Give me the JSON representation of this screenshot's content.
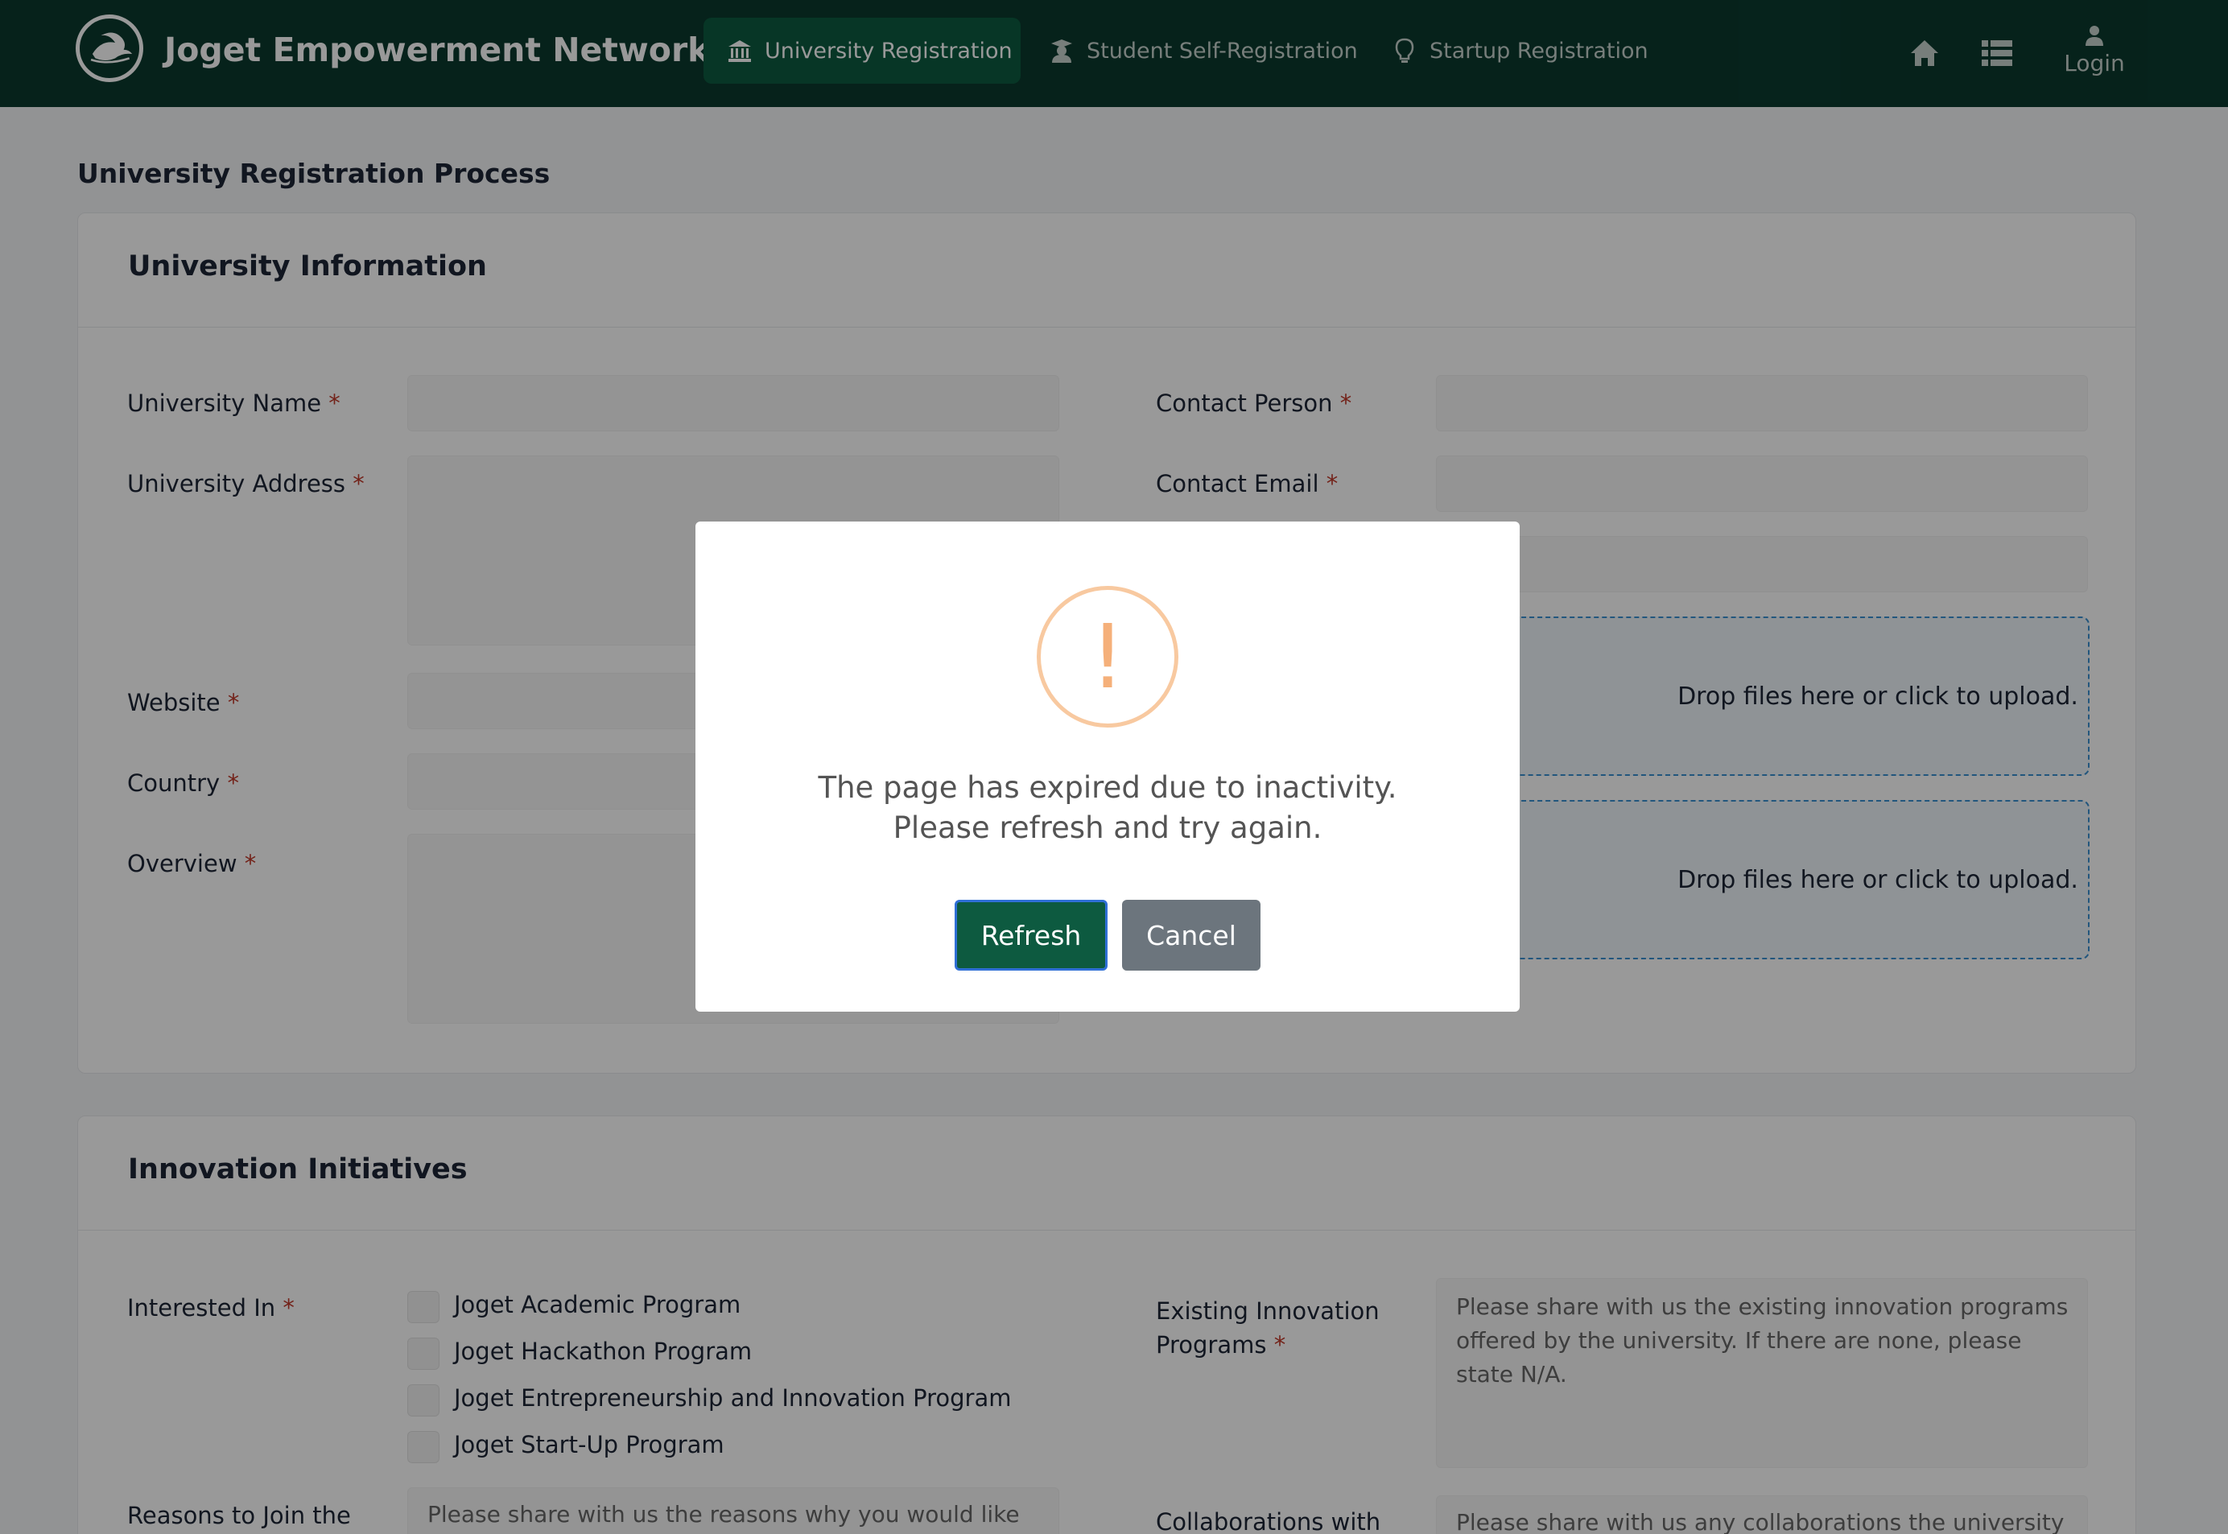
{
  "navbar": {
    "brand": "Joget Empowerment Network",
    "items": [
      {
        "label": "University Registration",
        "icon": "university-icon",
        "active": true
      },
      {
        "label": "Student Self-Registration",
        "icon": "graduate-icon",
        "active": false
      },
      {
        "label": "Startup Registration",
        "icon": "lightbulb-icon",
        "active": false
      }
    ],
    "home_icon": "home-icon",
    "list_icon": "list-icon",
    "login_label": "Login"
  },
  "page": {
    "title": "University Registration Process"
  },
  "university_info": {
    "title": "University Information",
    "fields": {
      "university_name": "University Name",
      "contact_person": "Contact Person",
      "university_address": "University Address",
      "contact_email": "Contact Email",
      "website": "Website",
      "country": "Country",
      "overview": "Overview"
    },
    "required_mark": "*",
    "dropzone_text_1": "Drop files here or click to upload.",
    "dropzone_text_2": "Drop files here or click to upload."
  },
  "innovation": {
    "title": "Innovation Initiatives",
    "interested_in_label": "Interested In",
    "options": [
      "Joget Academic Program",
      "Joget Hackathon Program",
      "Joget Entrepreneurship and Innovation Program",
      "Joget Start-Up Program"
    ],
    "existing_label_1": "Existing Innovation",
    "existing_label_2": "Programs",
    "existing_placeholder": "Please share with us the existing innovation programs offered by the university. If there are none, please state N/A.",
    "reasons_label": "Reasons to Join the",
    "reasons_placeholder": "Please share with us the reasons why you would like",
    "collab_label": "Collaborations with",
    "collab_placeholder": "Please share with us any collaborations the university"
  },
  "modal": {
    "icon": "!",
    "line1": "The page has expired due to inactivity.",
    "line2": "Please refresh and try again.",
    "refresh_label": "Refresh",
    "cancel_label": "Cancel"
  },
  "colors": {
    "navbar": "#0a3a2e",
    "accent": "#0d5a40",
    "warning": "#f5b07a",
    "required": "#c0392b"
  }
}
